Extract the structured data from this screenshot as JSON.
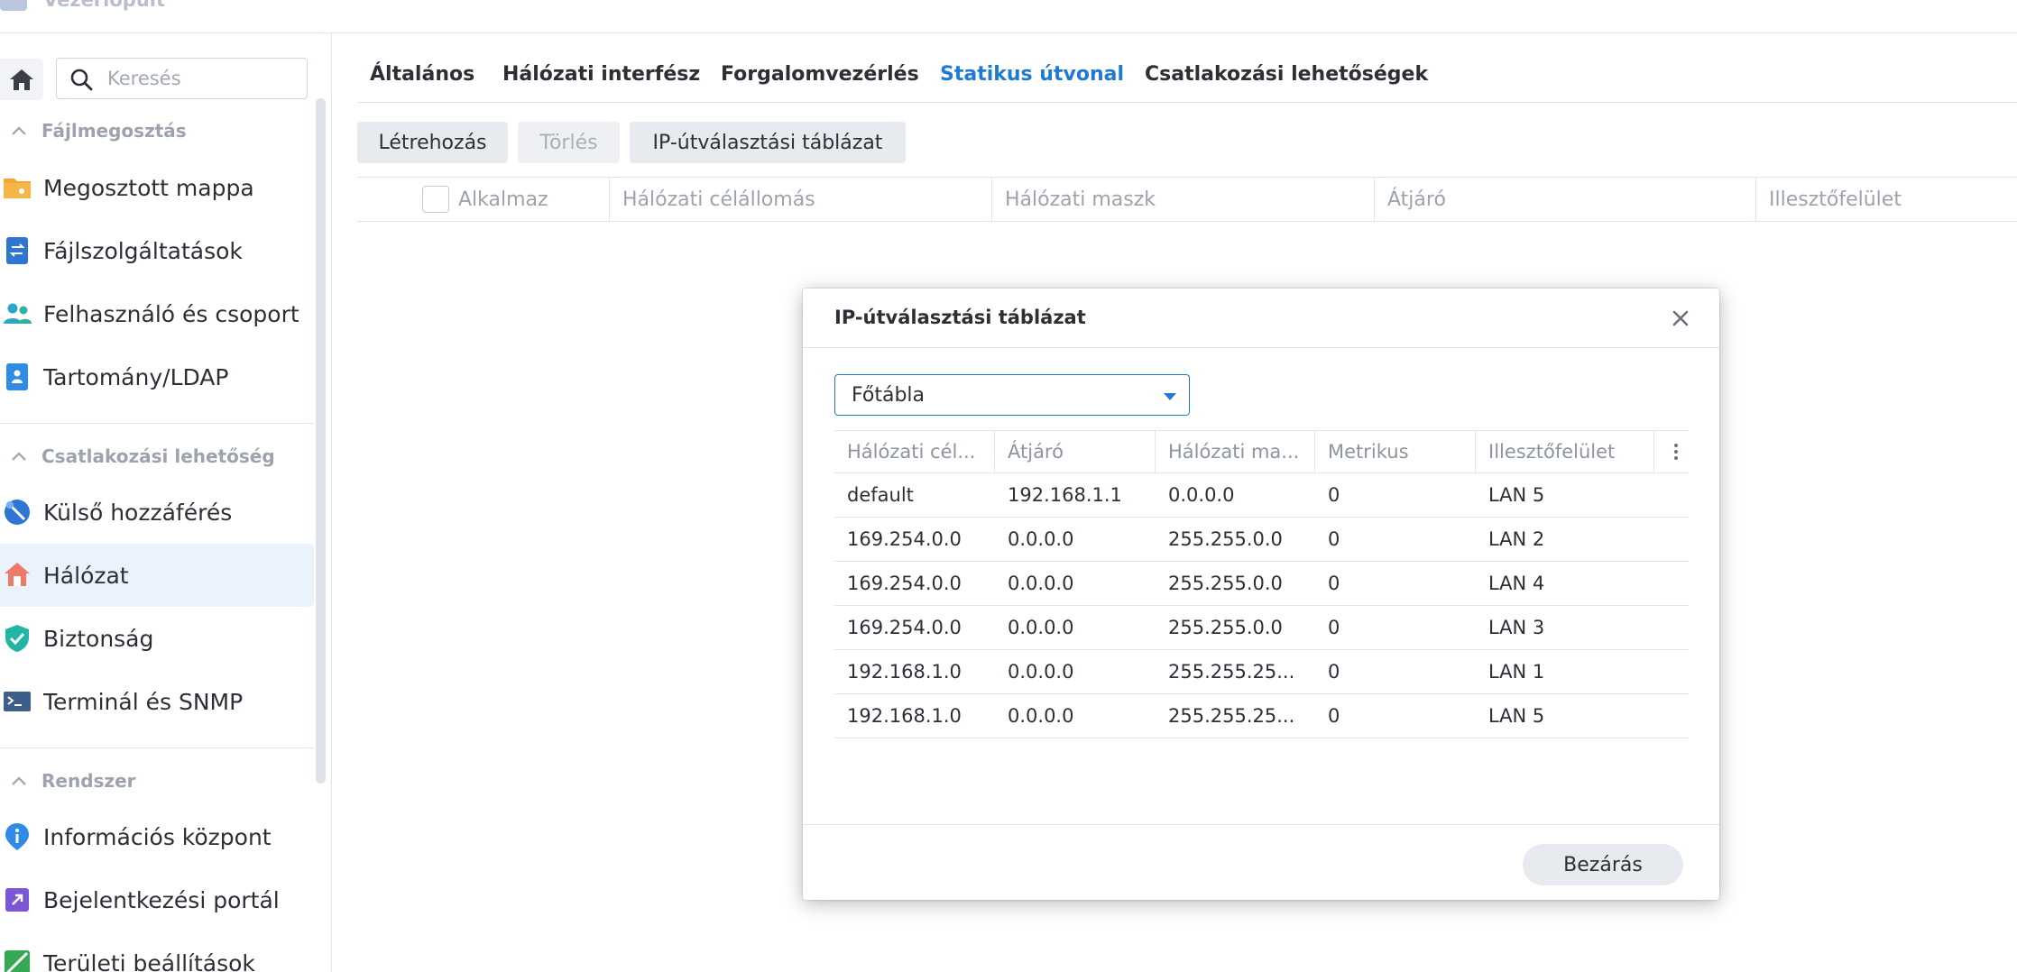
{
  "app": {
    "title": "Vezérlőpult"
  },
  "sidebar": {
    "search_placeholder": "Keresés",
    "sections": [
      {
        "label": "Fájlmegosztás"
      },
      {
        "label": "Csatlakozási lehetőség"
      },
      {
        "label": "Rendszer"
      }
    ],
    "items": [
      {
        "label": "Megosztott mappa",
        "icon": "folder-icon"
      },
      {
        "label": "Fájlszolgáltatások",
        "icon": "file-services-icon"
      },
      {
        "label": "Felhasználó és csoport",
        "icon": "users-icon"
      },
      {
        "label": "Tartomány/LDAP",
        "icon": "domain-icon"
      },
      {
        "label": "Külső hozzáférés",
        "icon": "external-access-icon"
      },
      {
        "label": "Hálózat",
        "icon": "network-house-icon"
      },
      {
        "label": "Biztonság",
        "icon": "shield-icon"
      },
      {
        "label": "Terminál és SNMP",
        "icon": "terminal-icon"
      },
      {
        "label": "Információs központ",
        "icon": "info-icon"
      },
      {
        "label": "Bejelentkezési portál",
        "icon": "login-portal-icon"
      },
      {
        "label": "Területi beállítások",
        "icon": "regional-icon"
      }
    ],
    "active_item": "Hálózat"
  },
  "tabs": [
    {
      "label": "Általános"
    },
    {
      "label": "Hálózati interfész"
    },
    {
      "label": "Forgalomvezérlés"
    },
    {
      "label": "Statikus útvonal"
    },
    {
      "label": "Csatlakozási lehetőségek"
    }
  ],
  "active_tab": "Statikus útvonal",
  "toolbar": {
    "create": "Létrehozás",
    "delete": "Törlés",
    "routing_table": "IP-útválasztási táblázat"
  },
  "grid": {
    "columns": [
      "Alkalmaz",
      "Hálózati célállomás",
      "Hálózati maszk",
      "Átjáró",
      "Illesztőfelület"
    ]
  },
  "modal": {
    "title": "IP-útválasztási táblázat",
    "select_value": "Főtábla",
    "columns": [
      "Hálózati cél...",
      "Átjáró",
      "Hálózati ma...",
      "Metrikus",
      "Illesztőfelület"
    ],
    "rows": [
      [
        "default",
        "192.168.1.1",
        "0.0.0.0",
        "0",
        "LAN 5"
      ],
      [
        "169.254.0.0",
        "0.0.0.0",
        "255.255.0.0",
        "0",
        "LAN 2"
      ],
      [
        "169.254.0.0",
        "0.0.0.0",
        "255.255.0.0",
        "0",
        "LAN 4"
      ],
      [
        "169.254.0.0",
        "0.0.0.0",
        "255.255.0.0",
        "0",
        "LAN 3"
      ],
      [
        "192.168.1.0",
        "0.0.0.0",
        "255.255.25...",
        "0",
        "LAN 1"
      ],
      [
        "192.168.1.0",
        "0.0.0.0",
        "255.255.25...",
        "0",
        "LAN 5"
      ]
    ],
    "close_button": "Bezárás"
  },
  "colors": {
    "accent": "#1f7ad4",
    "active_bg": "#eaf2fc",
    "muted_text": "#9ca3ad"
  }
}
